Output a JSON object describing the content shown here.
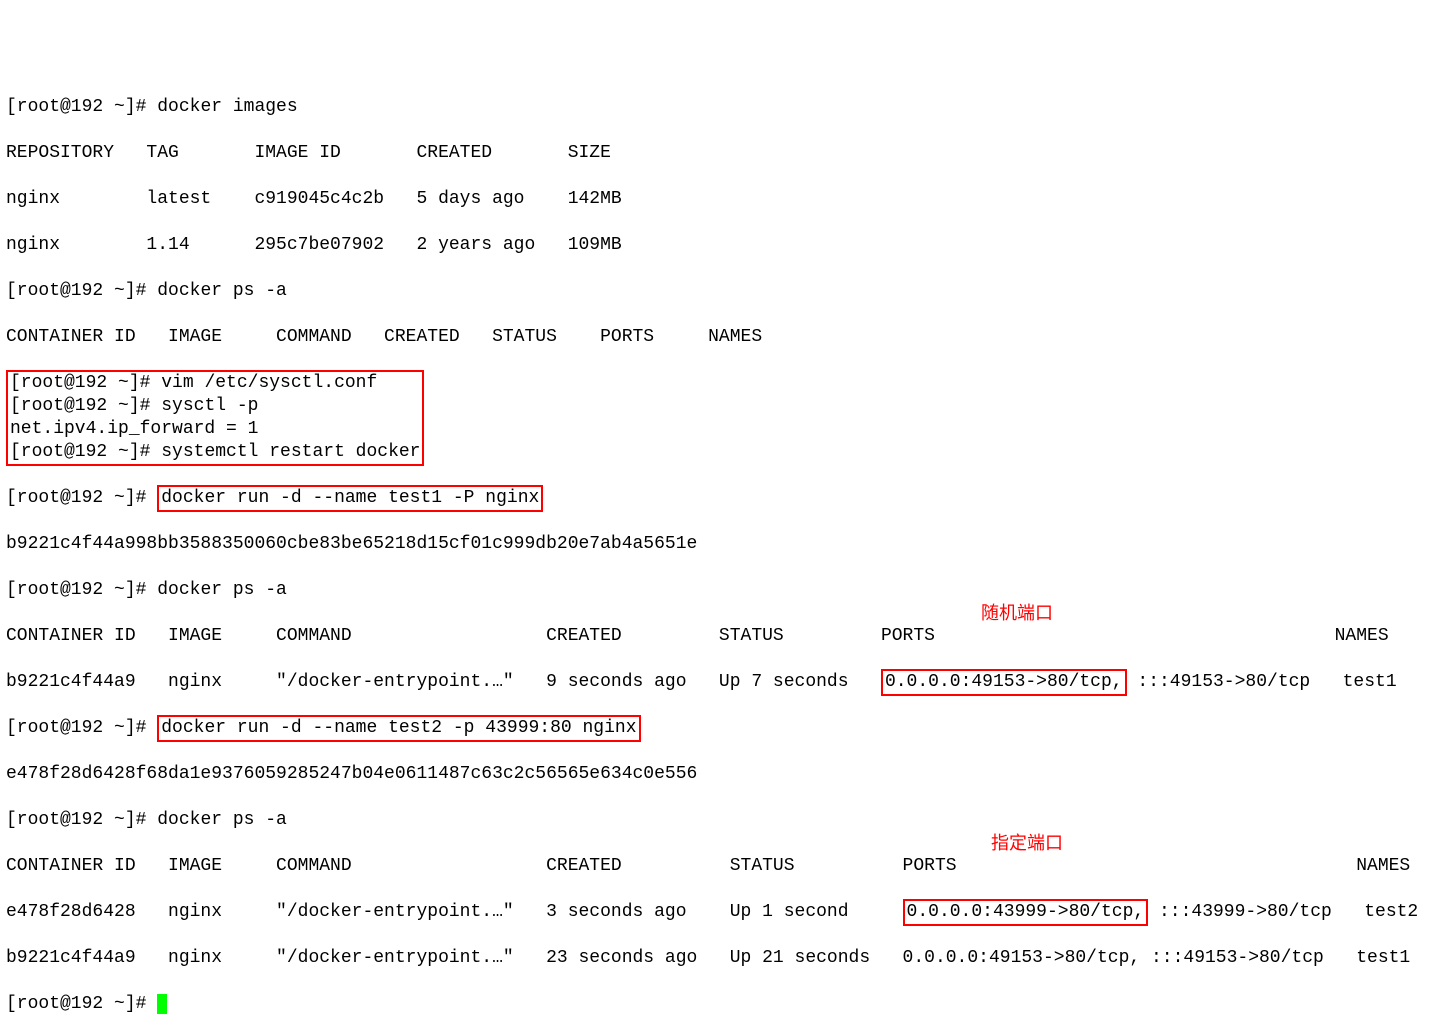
{
  "prompt": "[root@192 ~]# ",
  "cmd1": "docker images",
  "images_header": "REPOSITORY   TAG       IMAGE ID       CREATED       SIZE",
  "images_row1": "nginx        latest    c919045c4c2b   5 days ago    142MB",
  "images_row2": "nginx        1.14      295c7be07902   2 years ago   109MB",
  "cmd2": "docker ps -a",
  "ps_empty_header": "CONTAINER ID   IMAGE     COMMAND   CREATED   STATUS    PORTS     NAMES",
  "cmd3": "vim /etc/sysctl.conf",
  "cmd4": "sysctl -p",
  "sysctl_out": "net.ipv4.ip_forward = 1",
  "cmd5": "systemctl restart docker",
  "cmd6": "docker run -d --name test1 -P nginx",
  "hash1": "b9221c4f44a998bb3588350060cbe83be65218d15cf01c999db20e7ab4a5651e",
  "cmd7": "docker ps -a",
  "annot1": "随机端口",
  "ps_header2": "CONTAINER ID   IMAGE     COMMAND                  CREATED         STATUS         PORTS                                     NAMES",
  "ps_row2a_pre": "b9221c4f44a9   nginx     \"/docker-entrypoint.…\"   9 seconds ago   Up 7 seconds   ",
  "ps_row2a_port": "0.0.0.0:49153->80/tcp,",
  "ps_row2a_post": " :::49153->80/tcp   test1",
  "cmd8": "docker run -d --name test2 -p 43999:80 nginx",
  "hash2": "e478f28d6428f68da1e9376059285247b04e0611487c63c2c56565e634c0e556",
  "cmd9": "docker ps -a",
  "annot2": "指定端口",
  "ps_header3": "CONTAINER ID   IMAGE     COMMAND                  CREATED          STATUS          PORTS                                     NAMES",
  "ps_row3a_pre": "e478f28d6428   nginx     \"/docker-entrypoint.…\"   3 seconds ago    Up 1 second     ",
  "ps_row3a_port": "0.0.0.0:43999->80/tcp,",
  "ps_row3a_post": " :::43999->80/tcp   test2",
  "ps_row3b": "b9221c4f44a9   nginx     \"/docker-entrypoint.…\"   23 seconds ago   Up 21 seconds   0.0.0.0:49153->80/tcp, :::49153->80/tcp   test1"
}
